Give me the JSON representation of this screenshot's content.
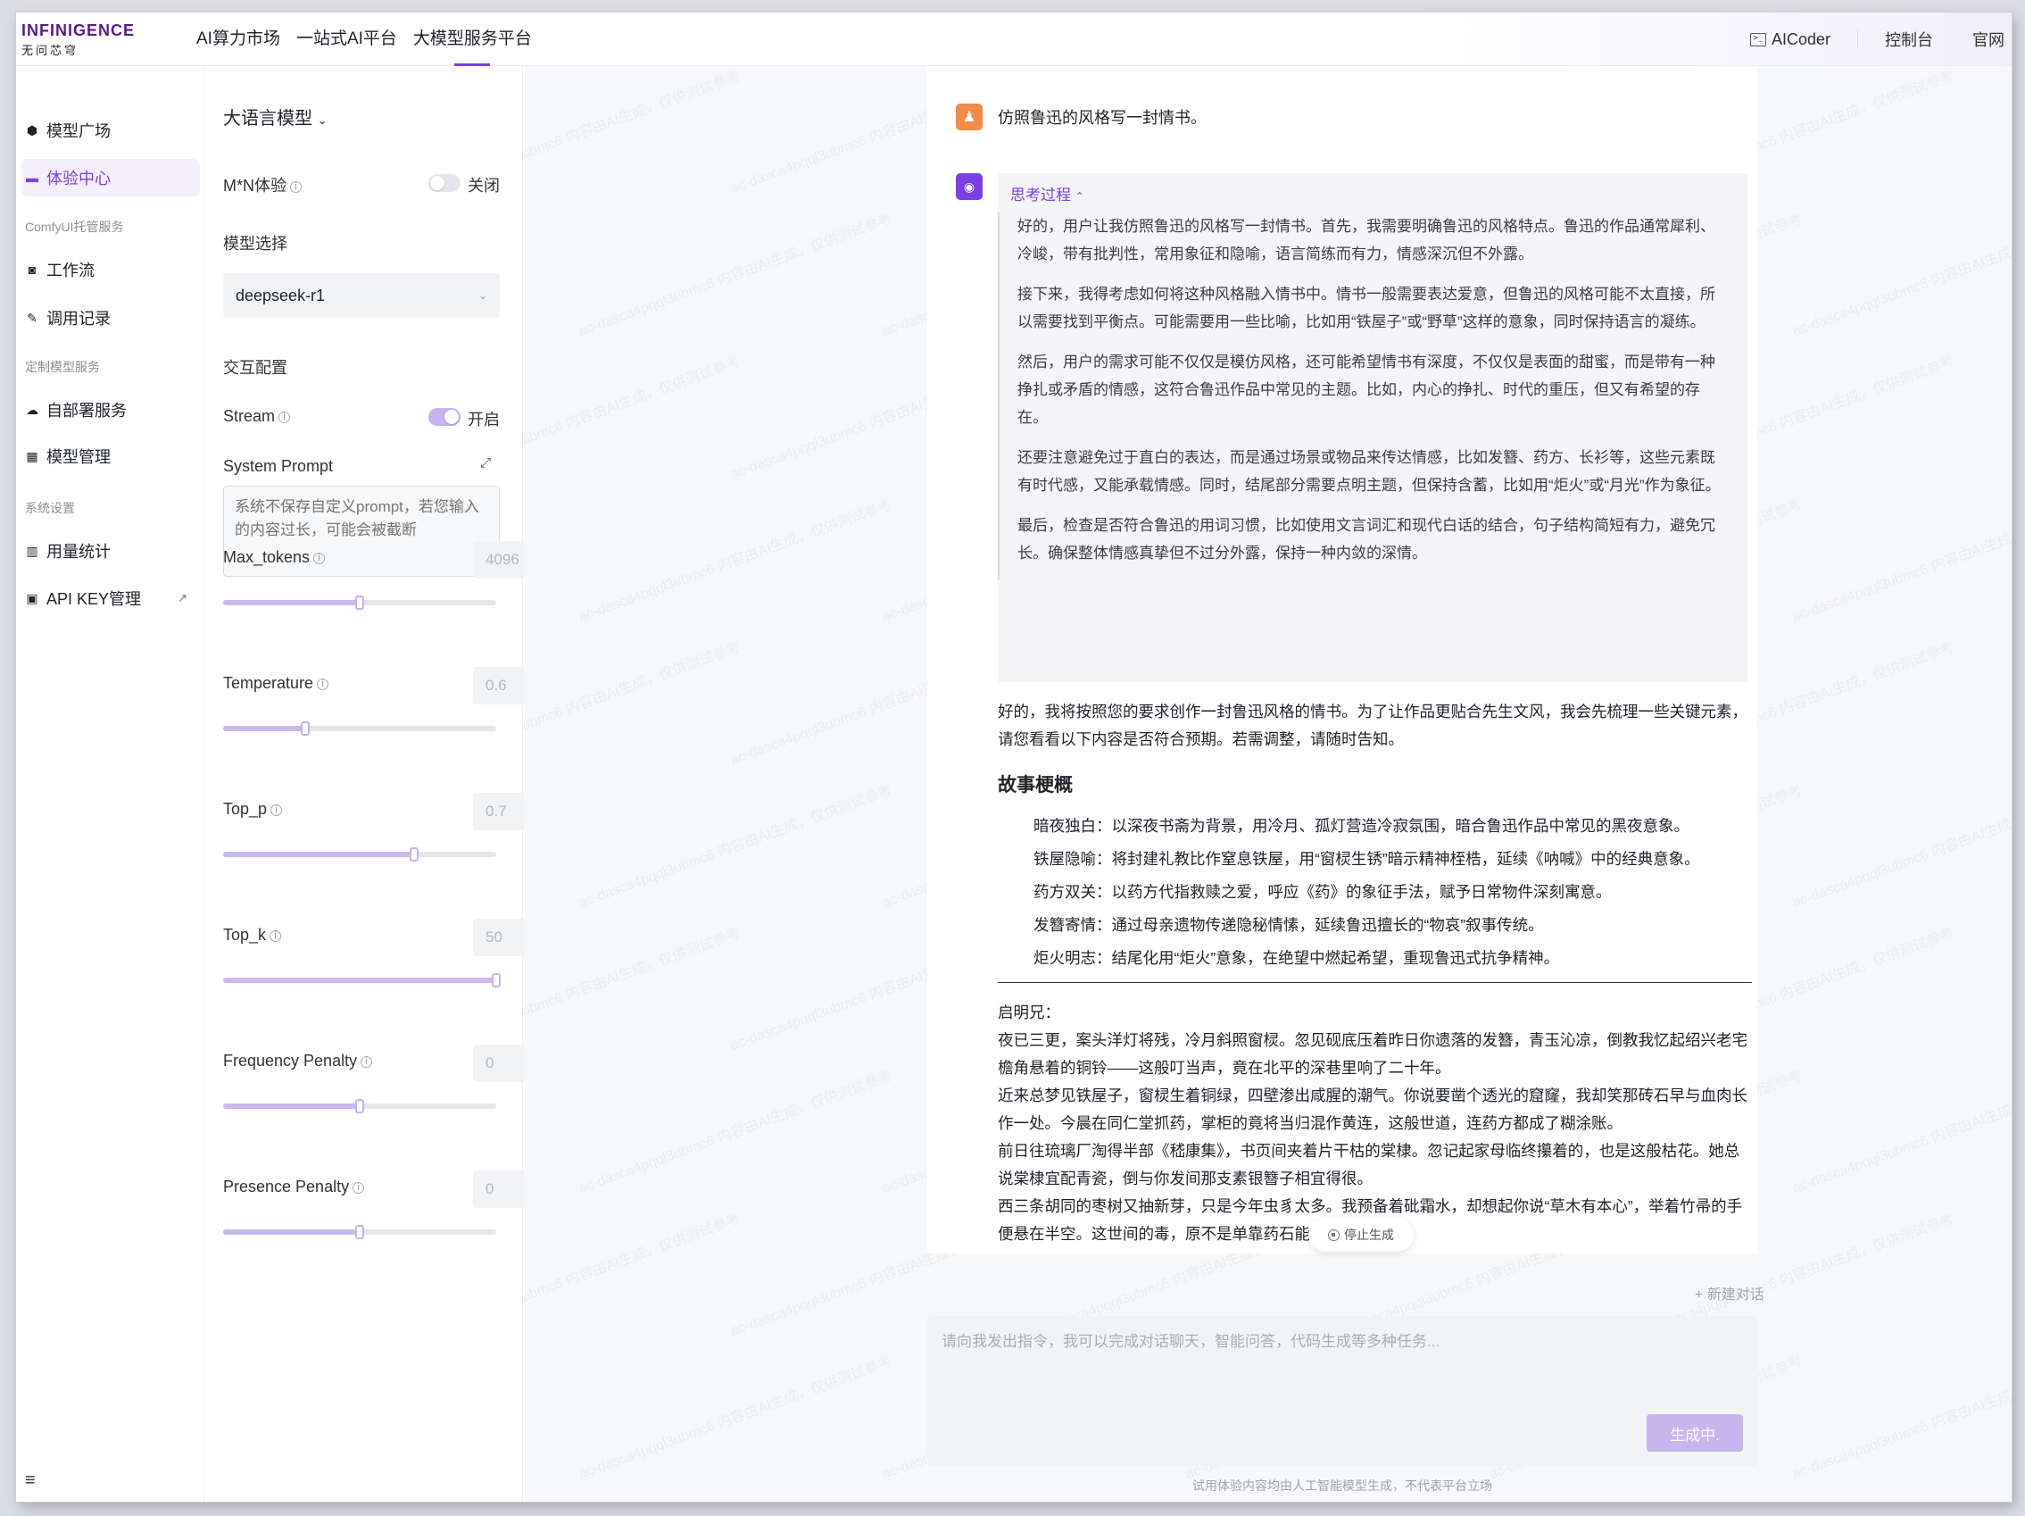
{
  "header": {
    "logo_line1": "INFINIGENCE",
    "logo_line2": "无问芯穹",
    "nav": [
      "AI算力市场",
      "一站式AI平台",
      "大模型服务平台"
    ],
    "aicoder": "AICoder",
    "console": "控制台",
    "site": "官网"
  },
  "sidebar": {
    "items": [
      {
        "label": "模型广场"
      },
      {
        "label": "体验中心"
      },
      {
        "label": "工作流"
      },
      {
        "label": "调用记录"
      },
      {
        "label": "自部署服务"
      },
      {
        "label": "模型管理"
      },
      {
        "label": "用量统计"
      },
      {
        "label": "API KEY管理"
      }
    ],
    "groups": [
      "ComfyUI托管服务",
      "定制模型服务",
      "系统设置"
    ],
    "menu_icon": "≡"
  },
  "panel": {
    "title": "大语言模型",
    "mn_label": "M*N体验",
    "mn_state": "关闭",
    "model_label": "模型选择",
    "model_value": "deepseek-r1",
    "interact_label": "交互配置",
    "stream_label": "Stream",
    "stream_state": "开启",
    "sysprompt_label": "System Prompt",
    "sysprompt_placeholder": "系统不保存自定义prompt，若您输入的内容过长，可能会被截断",
    "params": [
      {
        "label": "Max_tokens",
        "value": "4096",
        "fraction": 0.5
      },
      {
        "label": "Temperature",
        "value": "0.6",
        "fraction": 0.3
      },
      {
        "label": "Top_p",
        "value": "0.7",
        "fraction": 0.7
      },
      {
        "label": "Top_k",
        "value": "50",
        "fraction": 1.0
      },
      {
        "label": "Frequency Penalty",
        "value": "0",
        "fraction": 0.5
      },
      {
        "label": "Presence Penalty",
        "value": "0",
        "fraction": 0.5
      }
    ]
  },
  "chat": {
    "user_message": "仿照鲁迅的风格写一封情书。",
    "think_toggle": "思考过程",
    "think": [
      "好的，用户让我仿照鲁迅的风格写一封情书。首先，我需要明确鲁迅的风格特点。鲁迅的作品通常犀利、冷峻，带有批判性，常用象征和隐喻，语言简练而有力，情感深沉但不外露。",
      "接下来，我得考虑如何将这种风格融入情书中。情书一般需要表达爱意，但鲁迅的风格可能不太直接，所以需要找到平衡点。可能需要用一些比喻，比如用“铁屋子”或“野草”这样的意象，同时保持语言的凝练。",
      "然后，用户的需求可能不仅仅是模仿风格，还可能希望情书有深度，不仅仅是表面的甜蜜，而是带有一种挣扎或矛盾的情感，这符合鲁迅作品中常见的主题。比如，内心的挣扎、时代的重压，但又有希望的存在。",
      "还要注意避免过于直白的表达，而是通过场景或物品来传达情感，比如发簪、药方、长衫等，这些元素既有时代感，又能承载情感。同时，结尾部分需要点明主题，但保持含蓄，比如用“炬火”或“月光”作为象征。",
      "最后，检查是否符合鲁迅的用词习惯，比如使用文言词汇和现代白话的结合，句子结构简短有力，避免冗长。确保整体情感真挚但不过分外露，保持一种内敛的深情。"
    ],
    "answer_intro": "好的，我将按照您的要求创作一封鲁迅风格的情书。为了让作品更贴合先生文风，我会先梳理一些关键元素，请您看看以下内容是否符合预期。若需调整，请随时告知。",
    "outline_title": "故事梗概",
    "outline": [
      "暗夜独白：以深夜书斋为背景，用冷月、孤灯营造冷寂氛围，暗合鲁迅作品中常见的黑夜意象。",
      "铁屋隐喻：将封建礼教比作窒息铁屋，用“窗棂生锈”暗示精神桎梏，延续《呐喊》中的经典意象。",
      "药方双关：以药方代指救赎之爱，呼应《药》的象征手法，赋予日常物件深刻寓意。",
      "发簪寄情：通过母亲遗物传递隐秘情愫，延续鲁迅擅长的“物哀”叙事传统。",
      "炬火明志：结尾化用“炬火”意象，在绝望中燃起希望，重现鲁迅式抗争精神。"
    ],
    "letter": [
      "启明兄：",
      "夜已三更，案头洋灯将残，冷月斜照窗棂。忽见砚底压着昨日你遗落的发簪，青玉沁凉，倒教我忆起绍兴老宅檐角悬着的铜铃——这般叮当声，竟在北平的深巷里响了二十年。",
      "近来总梦见铁屋子，窗棂生着铜绿，四壁渗出咸腥的潮气。你说要凿个透光的窟窿，我却笑那砖石早与血肉长作一处。今晨在同仁堂抓药，掌柜的竟将当归混作黄连，这般世道，连药方都成了糊涂账。",
      "前日往琉璃厂淘得半部《嵇康集》，书页间夹着片干枯的棠棣。忽记起家母临终攥着的，也是这般枯花。她总说棠棣宜配青瓷，倒与你发间那支素银簪子相宜得很。",
      "西三条胡同的枣树又抽新芽，只是今年虫豸太多。我预备着砒霜水，却想起你说“草木有本心”，举着竹帚的手便悬在半空。这世间的毒，原不是单靠药石能"
    ],
    "stop_label": "停止生成",
    "new_chat": "+ 新建对话",
    "input_placeholder": "请向我发出指令，我可以完成对话聊天，智能问答，代码生成等多种任务...",
    "generating": "生成中.",
    "disclaimer": "试用体验内容均由人工智能模型生成，不代表平台立场"
  },
  "watermark": "ac-dasca4pqql3ubmc6 内容由AI生成，仅供测试参考",
  "colors": {
    "accent": "#7b3fe4",
    "user_avatar": "#f28b45",
    "button_disabled": "#c9b5ee"
  }
}
